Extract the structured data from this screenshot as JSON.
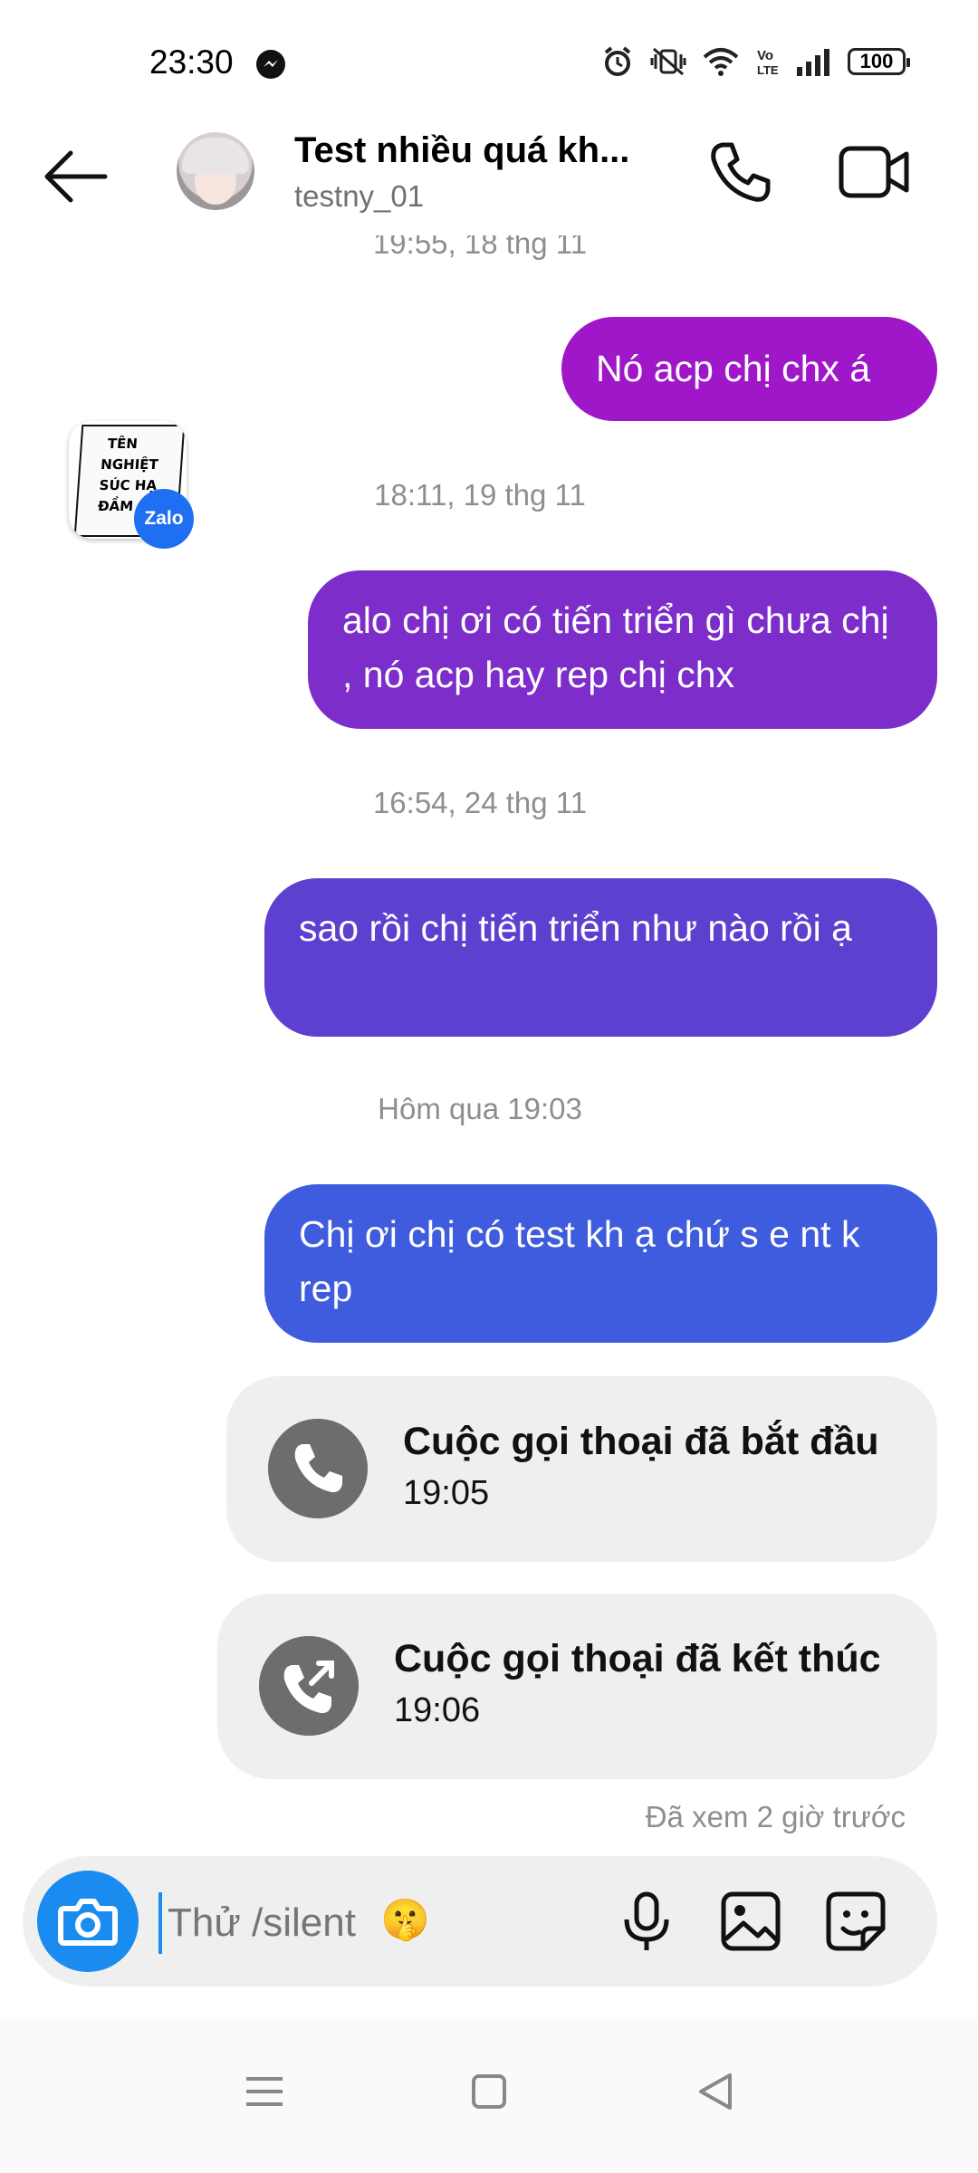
{
  "status_bar": {
    "time": "23:30",
    "battery": "100",
    "icons": [
      "messenger-icon",
      "alarm-icon",
      "vibrate-mute-icon",
      "wifi-icon",
      "volte-icon",
      "signal-icon",
      "battery-icon"
    ]
  },
  "header": {
    "title": "Test nhiều quá kh...",
    "username": "testny_01",
    "icons": [
      "back-arrow-icon",
      "phone-icon",
      "video-camera-icon"
    ]
  },
  "chat": {
    "top_partial_timestamp": "19:55, 18 thg 11",
    "messages": [
      {
        "text": "Nó acp chị chx á",
        "color": "#9f17c9"
      },
      {
        "timestamp": "18:11, 19 thg 11"
      },
      {
        "text": "alo chị ơi có tiến triển gì chưa chị , nó acp hay rep chị chx",
        "color": "#7d2dca"
      },
      {
        "timestamp": "16:54, 24 thg 11"
      },
      {
        "text": "sao rồi chị tiến triển như nào rồi ạ",
        "color": "#5e40d0"
      },
      {
        "timestamp": "Hôm qua 19:03"
      },
      {
        "text": "Chị ơi chị có test kh ạ chứ s e nt k rep",
        "color": "#3e5cdd"
      }
    ],
    "shared_image": {
      "text_lines": [
        "TÊN",
        "NGHIỆT",
        "SÚC HẠ",
        "ĐẦM"
      ],
      "badge": "Zalo"
    },
    "calls": [
      {
        "title": "Cuộc gọi thoại đã bắt đầu",
        "time": "19:05",
        "icon": "phone-icon"
      },
      {
        "title": "Cuộc gọi thoại đã kết thúc",
        "time": "19:06",
        "icon": "phone-outgoing-icon"
      }
    ],
    "seen": "Đã xem 2 giờ trước"
  },
  "composer": {
    "placeholder": "Thử /silent",
    "emoji": "🤫",
    "icons": [
      "camera-icon",
      "microphone-icon",
      "gallery-icon",
      "sticker-icon"
    ],
    "accent": "#1a8cf0"
  },
  "nav": {
    "icons": [
      "menu-icon",
      "home-square-icon",
      "back-triangle-icon"
    ]
  }
}
